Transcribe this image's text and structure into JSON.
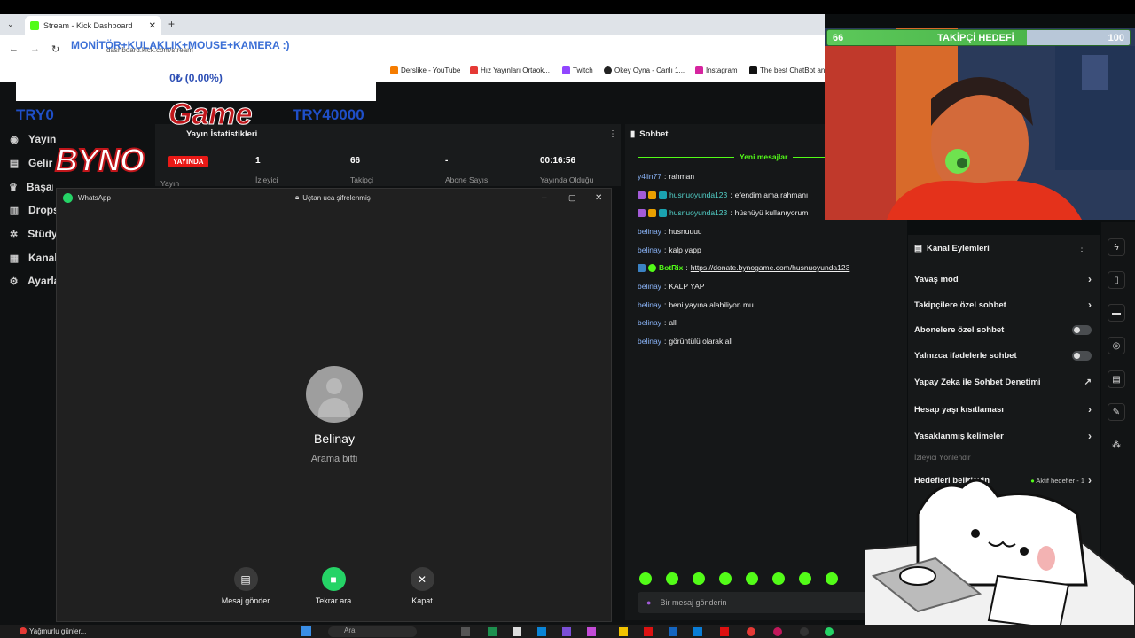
{
  "browser": {
    "tab_title": "Stream - Kick Dashboard",
    "url": "dashboard.kick.com/stream",
    "bookmarks": [
      "Derslike - YouTube",
      "Hız Yayınları Ortaok...",
      "Twitch",
      "Okey Oyna - Canlı 1...",
      "Instagram",
      "The best ChatBot an..."
    ]
  },
  "overlay": {
    "promo_text": "MONİTÖR+KULAKLIK+MOUSE+KAMERA :)",
    "donation_percent": "0₺ (0.00%)",
    "goal_start": "TRY0",
    "goal_end": "TRY40000",
    "logo_byno": "BYNO",
    "logo_game": "Game"
  },
  "follower_goal": {
    "current": "66",
    "label": "TAKİPÇİ HEDEFİ",
    "target": "100",
    "progress": 0.66
  },
  "sidebar": {
    "items": [
      {
        "label": "Yayın",
        "icon": "broadcast-icon"
      },
      {
        "label": "Gelir",
        "icon": "money-icon"
      },
      {
        "label": "Başarı",
        "icon": "trophy-icon"
      },
      {
        "label": "Drops",
        "icon": "gift-icon"
      },
      {
        "label": "Stüdyo",
        "icon": "gear-icon"
      },
      {
        "label": "Kanal",
        "icon": "channel-icon"
      },
      {
        "label": "Ayarlar",
        "icon": "settings-icon"
      }
    ]
  },
  "stats": {
    "title": "Yayın İstatistikleri",
    "live_badge": "YAYINDA",
    "live_label": "Yayın",
    "viewers_value": "1",
    "viewers_label": "İzleyici",
    "followers_value": "66",
    "followers_label": "Takipçi",
    "subs_value": "-",
    "subs_label": "Abone Sayısı",
    "uptime_value": "00:16:56",
    "uptime_label": "Yayında Olduğu"
  },
  "chat": {
    "title": "Sohbet",
    "new_messages": "Yeni mesajlar",
    "messages": [
      {
        "user": "y4lin77",
        "text": "rahman",
        "badges": false
      },
      {
        "user": "husnuoyunda123",
        "text": "efendim ama rahmanı",
        "badges": true
      },
      {
        "user": "husnuoyunda123",
        "text": "hüsnüyü kullanıyorum",
        "badges": true
      },
      {
        "user": "belinay",
        "text": "husnuuuu",
        "badges": false
      },
      {
        "user": "belinay",
        "text": "kalp yapp",
        "badges": false
      },
      {
        "user": "BotRix",
        "text": "https://donate.bynogame.com/husnuoyunda123",
        "badges": true
      },
      {
        "user": "belinay",
        "text": "KALP YAP",
        "badges": false
      },
      {
        "user": "belinay",
        "text": "beni yayına alabiliyon mu",
        "badges": false
      },
      {
        "user": "belinay",
        "text": "all",
        "badges": false
      },
      {
        "user": "belinay",
        "text": "görüntülü olarak all",
        "badges": false
      }
    ],
    "input_placeholder": "Bir mesaj gönderin"
  },
  "channel_actions": {
    "title": "Kanal Eylemleri",
    "items": [
      {
        "label": "Yavaş mod",
        "control": "chevron"
      },
      {
        "label": "Takipçilere özel sohbet",
        "control": "chevron"
      },
      {
        "label": "Abonelere özel sohbet",
        "control": "toggle"
      },
      {
        "label": "Yalnızca ifadelerle sohbet",
        "control": "toggle"
      },
      {
        "label": "Yapay Zeka ile Sohbet Denetimi",
        "control": "external"
      },
      {
        "label": "Hesap yaşı kısıtlaması",
        "control": "chevron"
      },
      {
        "label": "Yasaklanmış kelimeler",
        "control": "chevron"
      }
    ],
    "section_label": "İzleyici Yönlendir",
    "goals_label": "Hedefleri belirleyin",
    "goals_badge": "Aktif hedefler - 1"
  },
  "whatsapp": {
    "app_name": "WhatsApp",
    "encryption": "Uçtan uca şifrelenmiş",
    "contact_name": "Belinay",
    "call_status": "Arama bitti",
    "btn_message": "Mesaj gönder",
    "btn_call_again": "Tekrar ara",
    "btn_close": "Kapat"
  },
  "taskbar": {
    "weather": "Yağmurlu günler...",
    "search": "Ara"
  },
  "colors": {
    "kick_green": "#53fc18",
    "wa_green": "#25d366",
    "live_red": "#e91916"
  }
}
